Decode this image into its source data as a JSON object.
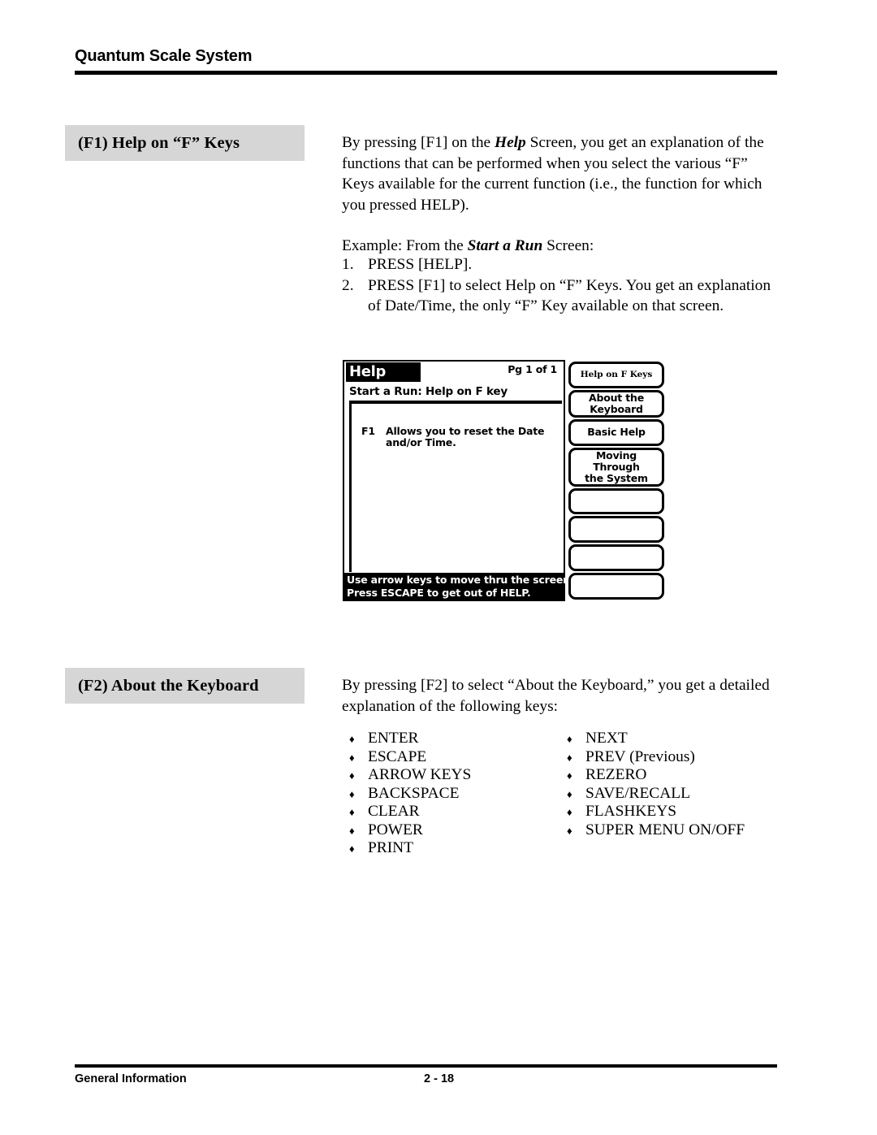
{
  "header": {
    "title": "Quantum Scale System"
  },
  "sections": [
    {
      "heading": "(F1)  Help on “F” Keys",
      "paragraph_1_a": "By pressing [F1] on the ",
      "paragraph_1_b": "Help",
      "paragraph_1_c": " Screen, you get an explanation of the functions that can be performed when you select the various “F” Keys available for the current function (i.e., the function for which you pressed HELP).",
      "paragraph_2_a": "Example:  From the ",
      "paragraph_2_b": "Start a Run",
      "paragraph_2_c": " Screen:",
      "steps": [
        {
          "num": "1.",
          "text": "PRESS [HELP]."
        },
        {
          "num": "2.",
          "text": "PRESS [F1] to select Help on “F” Keys.  You get an explanation of Date/Time, the only “F” Key available on that screen."
        }
      ]
    },
    {
      "heading": "(F2)  About the Keyboard",
      "paragraph": "By pressing [F2] to select “About the Keyboard,” you get a detailed explanation of the following keys:"
    }
  ],
  "lcd_screen": {
    "title": "Help",
    "page_indicator": "Pg 1 of 1",
    "subtitle": "Start a Run:  Help on F key",
    "entries": [
      {
        "key": "F1",
        "description": "Allows you to reset the Date and/or Time."
      }
    ],
    "status_line_1": "Use arrow keys to move thru the screens.",
    "status_line_2": "Press ESCAPE to get out of HELP.",
    "soft_keys": [
      {
        "label": "Help on F Keys",
        "ornate": true
      },
      {
        "label": "About the\nKeyboard",
        "ornate": false
      },
      {
        "label": "Basic Help",
        "ornate": false
      },
      {
        "label": "Moving Through\nthe System",
        "ornate": false
      },
      {
        "label": "",
        "ornate": false
      },
      {
        "label": "",
        "ornate": false
      },
      {
        "label": "",
        "ornate": false
      },
      {
        "label": "",
        "ornate": false
      }
    ]
  },
  "key_list": {
    "bullet_glyph": "♦",
    "left_column": [
      "ENTER",
      "ESCAPE",
      "ARROW KEYS",
      "BACKSPACE",
      "CLEAR",
      "POWER",
      "PRINT"
    ],
    "right_column": [
      "NEXT",
      "PREV (Previous)",
      "REZERO",
      "SAVE/RECALL",
      "FLASHKEYS",
      "SUPER MENU ON/OFF"
    ]
  },
  "footer": {
    "section_label": "General Information",
    "page_number": "2 - 18"
  },
  "colors": {
    "heading_box": "#d6d6d6",
    "text": "#000000",
    "page_background": "#ffffff"
  }
}
